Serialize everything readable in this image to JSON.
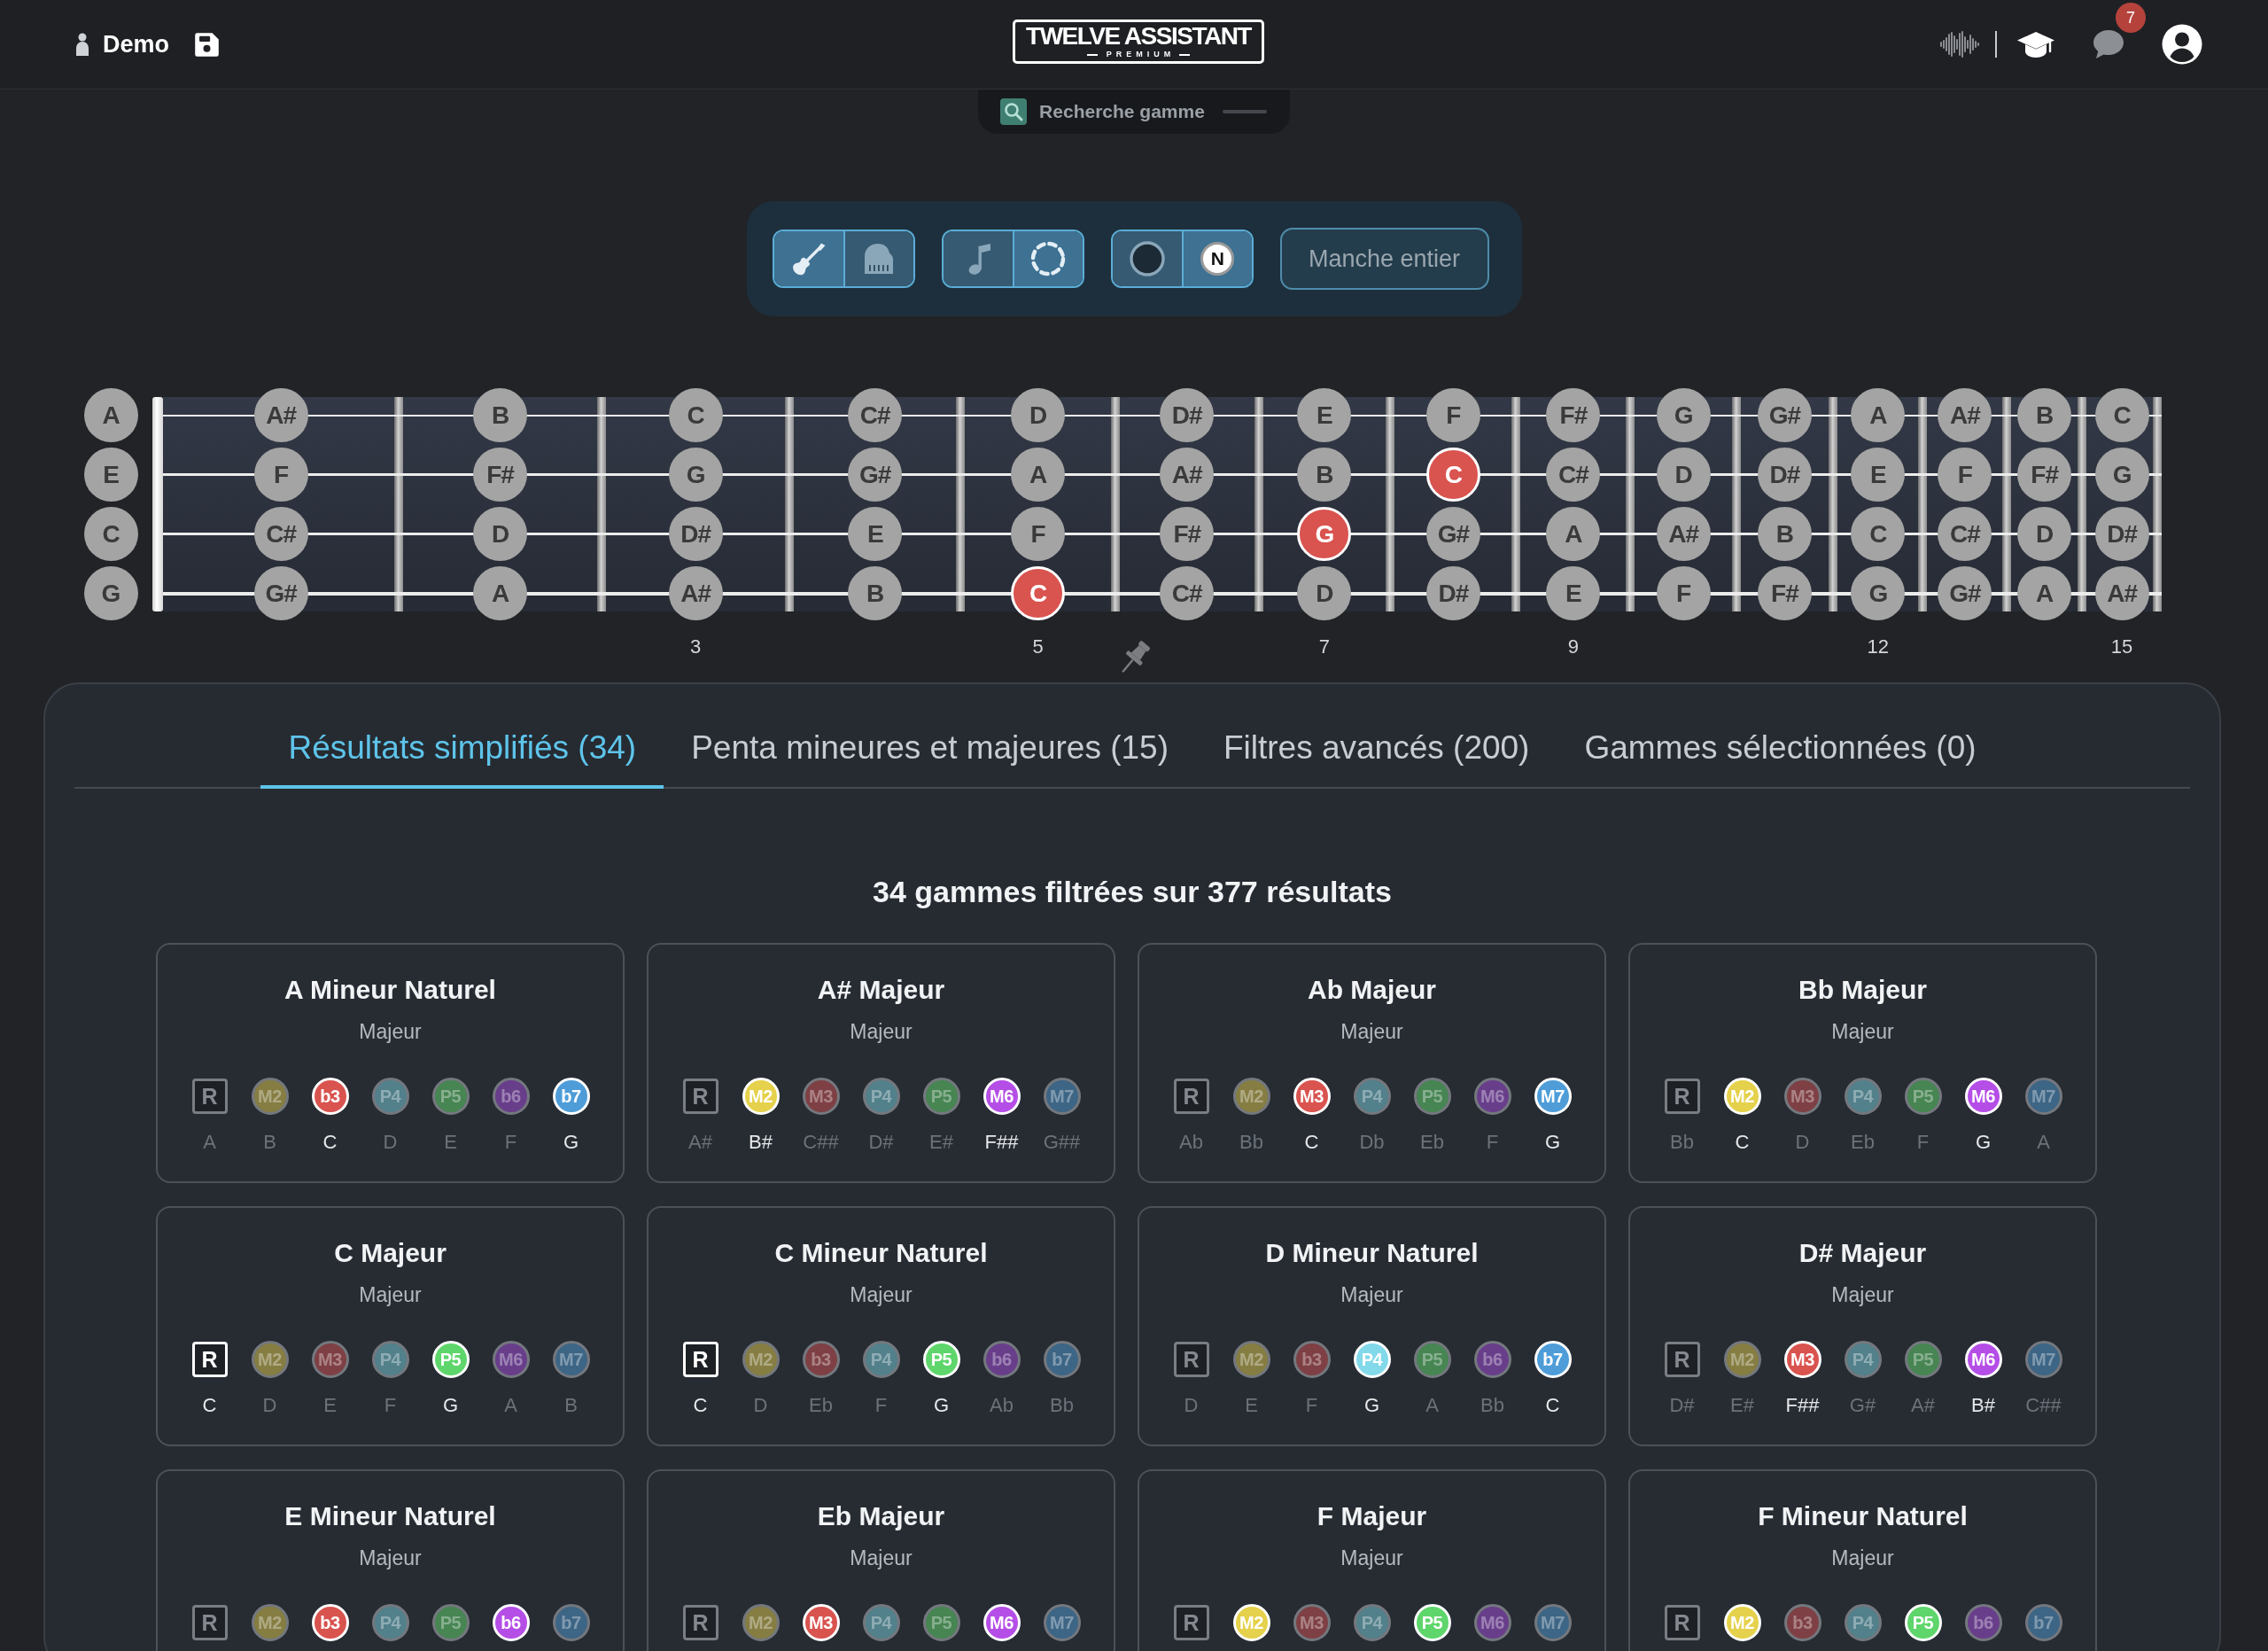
{
  "navbar": {
    "title": "Demo",
    "logo": {
      "title": "TWELVE ASSISTANT",
      "subtitle": "PREMIUM"
    },
    "notification_count": "7"
  },
  "search_tab": {
    "label": "Recherche gamme"
  },
  "toolbar": {
    "groups": [
      [
        {
          "selected": true
        },
        {
          "selected": false
        }
      ],
      [
        {
          "selected": false
        },
        {
          "selected": true
        }
      ],
      [
        {
          "selected": false
        },
        {
          "selected": true,
          "label": "N"
        }
      ]
    ],
    "full_neck_button": "Manche entier"
  },
  "fretboard": {
    "open_strings": [
      {
        "label": "A"
      },
      {
        "label": "E"
      },
      {
        "label": "C"
      },
      {
        "label": "G"
      }
    ],
    "frets": [
      {
        "notes": [
          {
            "label": "A#",
            "highlighted": false
          },
          {
            "label": "F",
            "highlighted": false
          },
          {
            "label": "C#",
            "highlighted": false
          },
          {
            "label": "G#",
            "highlighted": false
          }
        ]
      },
      {
        "notes": [
          {
            "label": "B",
            "highlighted": false
          },
          {
            "label": "F#",
            "highlighted": false
          },
          {
            "label": "D",
            "highlighted": false
          },
          {
            "label": "A",
            "highlighted": false
          }
        ]
      },
      {
        "notes": [
          {
            "label": "C",
            "highlighted": false
          },
          {
            "label": "G",
            "highlighted": false
          },
          {
            "label": "D#",
            "highlighted": false
          },
          {
            "label": "A#",
            "highlighted": false
          }
        ],
        "marker": "3"
      },
      {
        "notes": [
          {
            "label": "C#",
            "highlighted": false
          },
          {
            "label": "G#",
            "highlighted": false
          },
          {
            "label": "E",
            "highlighted": false
          },
          {
            "label": "B",
            "highlighted": false
          }
        ]
      },
      {
        "notes": [
          {
            "label": "D",
            "highlighted": false
          },
          {
            "label": "A",
            "highlighted": false
          },
          {
            "label": "F",
            "highlighted": false
          },
          {
            "label": "C",
            "highlighted": true
          }
        ],
        "marker": "5"
      },
      {
        "notes": [
          {
            "label": "D#",
            "highlighted": false
          },
          {
            "label": "A#",
            "highlighted": false
          },
          {
            "label": "F#",
            "highlighted": false
          },
          {
            "label": "C#",
            "highlighted": false
          }
        ]
      },
      {
        "notes": [
          {
            "label": "E",
            "highlighted": false
          },
          {
            "label": "B",
            "highlighted": false
          },
          {
            "label": "G",
            "highlighted": true
          },
          {
            "label": "D",
            "highlighted": false
          }
        ],
        "marker": "7"
      },
      {
        "notes": [
          {
            "label": "F",
            "highlighted": false
          },
          {
            "label": "C",
            "highlighted": true
          },
          {
            "label": "G#",
            "highlighted": false
          },
          {
            "label": "D#",
            "highlighted": false
          }
        ]
      },
      {
        "notes": [
          {
            "label": "F#",
            "highlighted": false
          },
          {
            "label": "C#",
            "highlighted": false
          },
          {
            "label": "A",
            "highlighted": false
          },
          {
            "label": "E",
            "highlighted": false
          }
        ],
        "marker": "9"
      },
      {
        "notes": [
          {
            "label": "G",
            "highlighted": false
          },
          {
            "label": "D",
            "highlighted": false
          },
          {
            "label": "A#",
            "highlighted": false
          },
          {
            "label": "F",
            "highlighted": false
          }
        ]
      },
      {
        "notes": [
          {
            "label": "G#",
            "highlighted": false
          },
          {
            "label": "D#",
            "highlighted": false
          },
          {
            "label": "B",
            "highlighted": false
          },
          {
            "label": "F#",
            "highlighted": false
          }
        ]
      },
      {
        "notes": [
          {
            "label": "A",
            "highlighted": false
          },
          {
            "label": "E",
            "highlighted": false
          },
          {
            "label": "C",
            "highlighted": false
          },
          {
            "label": "G",
            "highlighted": false
          }
        ],
        "marker": "12"
      },
      {
        "notes": [
          {
            "label": "A#",
            "highlighted": false
          },
          {
            "label": "F",
            "highlighted": false
          },
          {
            "label": "C#",
            "highlighted": false
          },
          {
            "label": "G#",
            "highlighted": false
          }
        ]
      },
      {
        "notes": [
          {
            "label": "B",
            "highlighted": false
          },
          {
            "label": "F#",
            "highlighted": false
          },
          {
            "label": "D",
            "highlighted": false
          },
          {
            "label": "A",
            "highlighted": false
          }
        ]
      },
      {
        "notes": [
          {
            "label": "C",
            "highlighted": false
          },
          {
            "label": "G",
            "highlighted": false
          },
          {
            "label": "D#",
            "highlighted": false
          },
          {
            "label": "A#",
            "highlighted": false
          }
        ],
        "marker": "15"
      }
    ]
  },
  "results": {
    "tabs": [
      {
        "label": "Résultats simplifiés (34)",
        "selected": true
      },
      {
        "label": "Penta mineures et majeures (15)",
        "selected": false
      },
      {
        "label": "Filtres avancés (200)",
        "selected": false
      },
      {
        "label": "Gammes sélectionnées (0)",
        "selected": false
      }
    ],
    "summary": "34 gammes filtrées sur 377 résultats",
    "scales": [
      {
        "title": "A Mineur Naturel",
        "subtitle": "Majeur",
        "intervals": [
          {
            "kind": "root",
            "label": "R",
            "note": "A",
            "active": false
          },
          {
            "kind": "degree",
            "label": "M2",
            "note": "B",
            "active": false,
            "color": "#857d42"
          },
          {
            "kind": "degree",
            "label": "b3",
            "note": "C",
            "active": true,
            "color": "#d9534f"
          },
          {
            "kind": "degree",
            "label": "P4",
            "note": "D",
            "active": false,
            "color": "#52808b"
          },
          {
            "kind": "degree",
            "label": "P5",
            "note": "E",
            "active": false,
            "color": "#478553"
          },
          {
            "kind": "degree",
            "label": "b6",
            "note": "F",
            "active": false,
            "color": "#683e8b"
          },
          {
            "kind": "degree",
            "label": "b7",
            "note": "G",
            "active": true,
            "color": "#4e9dd8"
          }
        ]
      },
      {
        "title": "A# Majeur",
        "subtitle": "Majeur",
        "intervals": [
          {
            "kind": "root",
            "label": "R",
            "note": "A#",
            "active": false
          },
          {
            "kind": "degree",
            "label": "M2",
            "note": "B#",
            "active": true,
            "color": "#e5d14b"
          },
          {
            "kind": "degree",
            "label": "M3",
            "note": "C##",
            "active": false,
            "color": "#7e4044"
          },
          {
            "kind": "degree",
            "label": "P4",
            "note": "D#",
            "active": false,
            "color": "#52808b"
          },
          {
            "kind": "degree",
            "label": "P5",
            "note": "E#",
            "active": false,
            "color": "#478553"
          },
          {
            "kind": "degree",
            "label": "M6",
            "note": "F##",
            "active": true,
            "color": "#b54ee6"
          },
          {
            "kind": "degree",
            "label": "M7",
            "note": "G##",
            "active": false,
            "color": "#3d6585"
          }
        ]
      },
      {
        "title": "Ab Majeur",
        "subtitle": "Majeur",
        "intervals": [
          {
            "kind": "root",
            "label": "R",
            "note": "Ab",
            "active": false
          },
          {
            "kind": "degree",
            "label": "M2",
            "note": "Bb",
            "active": false,
            "color": "#857d42"
          },
          {
            "kind": "degree",
            "label": "M3",
            "note": "C",
            "active": true,
            "color": "#d9534f"
          },
          {
            "kind": "degree",
            "label": "P4",
            "note": "Db",
            "active": false,
            "color": "#52808b"
          },
          {
            "kind": "degree",
            "label": "P5",
            "note": "Eb",
            "active": false,
            "color": "#478553"
          },
          {
            "kind": "degree",
            "label": "M6",
            "note": "F",
            "active": false,
            "color": "#683e8b"
          },
          {
            "kind": "degree",
            "label": "M7",
            "note": "G",
            "active": true,
            "color": "#4e9dd8"
          }
        ]
      },
      {
        "title": "Bb Majeur",
        "subtitle": "Majeur",
        "intervals": [
          {
            "kind": "root",
            "label": "R",
            "note": "Bb",
            "active": false
          },
          {
            "kind": "degree",
            "label": "M2",
            "note": "C",
            "active": true,
            "color": "#e5d14b"
          },
          {
            "kind": "degree",
            "label": "M3",
            "note": "D",
            "active": false,
            "color": "#7e4044"
          },
          {
            "kind": "degree",
            "label": "P4",
            "note": "Eb",
            "active": false,
            "color": "#52808b"
          },
          {
            "kind": "degree",
            "label": "P5",
            "note": "F",
            "active": false,
            "color": "#478553"
          },
          {
            "kind": "degree",
            "label": "M6",
            "note": "G",
            "active": true,
            "color": "#b54ee6"
          },
          {
            "kind": "degree",
            "label": "M7",
            "note": "A",
            "active": false,
            "color": "#3d6585"
          }
        ]
      },
      {
        "title": "C Majeur",
        "subtitle": "Majeur",
        "intervals": [
          {
            "kind": "root",
            "label": "R",
            "note": "C",
            "active": true
          },
          {
            "kind": "degree",
            "label": "M2",
            "note": "D",
            "active": false,
            "color": "#857d42"
          },
          {
            "kind": "degree",
            "label": "M3",
            "note": "E",
            "active": false,
            "color": "#7e4044"
          },
          {
            "kind": "degree",
            "label": "P4",
            "note": "F",
            "active": false,
            "color": "#52808b"
          },
          {
            "kind": "degree",
            "label": "P5",
            "note": "G",
            "active": true,
            "color": "#5ed66b"
          },
          {
            "kind": "degree",
            "label": "M6",
            "note": "A",
            "active": false,
            "color": "#683e8b"
          },
          {
            "kind": "degree",
            "label": "M7",
            "note": "B",
            "active": false,
            "color": "#3d6585"
          }
        ]
      },
      {
        "title": "C Mineur Naturel",
        "subtitle": "Majeur",
        "intervals": [
          {
            "kind": "root",
            "label": "R",
            "note": "C",
            "active": true
          },
          {
            "kind": "degree",
            "label": "M2",
            "note": "D",
            "active": false,
            "color": "#857d42"
          },
          {
            "kind": "degree",
            "label": "b3",
            "note": "Eb",
            "active": false,
            "color": "#7e4044"
          },
          {
            "kind": "degree",
            "label": "P4",
            "note": "F",
            "active": false,
            "color": "#52808b"
          },
          {
            "kind": "degree",
            "label": "P5",
            "note": "G",
            "active": true,
            "color": "#5ed66b"
          },
          {
            "kind": "degree",
            "label": "b6",
            "note": "Ab",
            "active": false,
            "color": "#683e8b"
          },
          {
            "kind": "degree",
            "label": "b7",
            "note": "Bb",
            "active": false,
            "color": "#3d6585"
          }
        ]
      },
      {
        "title": "D Mineur Naturel",
        "subtitle": "Majeur",
        "intervals": [
          {
            "kind": "root",
            "label": "R",
            "note": "D",
            "active": false
          },
          {
            "kind": "degree",
            "label": "M2",
            "note": "E",
            "active": false,
            "color": "#857d42"
          },
          {
            "kind": "degree",
            "label": "b3",
            "note": "F",
            "active": false,
            "color": "#7e4044"
          },
          {
            "kind": "degree",
            "label": "P4",
            "note": "G",
            "active": true,
            "color": "#82d9ea"
          },
          {
            "kind": "degree",
            "label": "P5",
            "note": "A",
            "active": false,
            "color": "#478553"
          },
          {
            "kind": "degree",
            "label": "b6",
            "note": "Bb",
            "active": false,
            "color": "#683e8b"
          },
          {
            "kind": "degree",
            "label": "b7",
            "note": "C",
            "active": true,
            "color": "#4e9dd8"
          }
        ]
      },
      {
        "title": "D# Majeur",
        "subtitle": "Majeur",
        "intervals": [
          {
            "kind": "root",
            "label": "R",
            "note": "D#",
            "active": false
          },
          {
            "kind": "degree",
            "label": "M2",
            "note": "E#",
            "active": false,
            "color": "#857d42"
          },
          {
            "kind": "degree",
            "label": "M3",
            "note": "F##",
            "active": true,
            "color": "#d9534f"
          },
          {
            "kind": "degree",
            "label": "P4",
            "note": "G#",
            "active": false,
            "color": "#52808b"
          },
          {
            "kind": "degree",
            "label": "P5",
            "note": "A#",
            "active": false,
            "color": "#478553"
          },
          {
            "kind": "degree",
            "label": "M6",
            "note": "B#",
            "active": true,
            "color": "#b54ee6"
          },
          {
            "kind": "degree",
            "label": "M7",
            "note": "C##",
            "active": false,
            "color": "#3d6585"
          }
        ]
      },
      {
        "title": "E Mineur Naturel",
        "subtitle": "Majeur",
        "intervals": [
          {
            "kind": "root",
            "label": "R",
            "active": false
          },
          {
            "kind": "degree",
            "label": "M2",
            "active": false,
            "color": "#857d42"
          },
          {
            "kind": "degree",
            "label": "b3",
            "active": true,
            "color": "#d9534f"
          },
          {
            "kind": "degree",
            "label": "P4",
            "active": false,
            "color": "#52808b"
          },
          {
            "kind": "degree",
            "label": "P5",
            "active": false,
            "color": "#478553"
          },
          {
            "kind": "degree",
            "label": "b6",
            "active": true,
            "color": "#b54ee6"
          },
          {
            "kind": "degree",
            "label": "b7",
            "active": false,
            "color": "#3d6585"
          }
        ]
      },
      {
        "title": "Eb Majeur",
        "subtitle": "Majeur",
        "intervals": [
          {
            "kind": "root",
            "label": "R",
            "active": false
          },
          {
            "kind": "degree",
            "label": "M2",
            "active": false,
            "color": "#857d42"
          },
          {
            "kind": "degree",
            "label": "M3",
            "active": true,
            "color": "#d9534f"
          },
          {
            "kind": "degree",
            "label": "P4",
            "active": false,
            "color": "#52808b"
          },
          {
            "kind": "degree",
            "label": "P5",
            "active": false,
            "color": "#478553"
          },
          {
            "kind": "degree",
            "label": "M6",
            "active": true,
            "color": "#b54ee6"
          },
          {
            "kind": "degree",
            "label": "M7",
            "active": false,
            "color": "#3d6585"
          }
        ]
      },
      {
        "title": "F Majeur",
        "subtitle": "Majeur",
        "intervals": [
          {
            "kind": "root",
            "label": "R",
            "active": false
          },
          {
            "kind": "degree",
            "label": "M2",
            "active": true,
            "color": "#e5d14b"
          },
          {
            "kind": "degree",
            "label": "M3",
            "active": false,
            "color": "#7e4044"
          },
          {
            "kind": "degree",
            "label": "P4",
            "active": false,
            "color": "#52808b"
          },
          {
            "kind": "degree",
            "label": "P5",
            "active": true,
            "color": "#5ed66b"
          },
          {
            "kind": "degree",
            "label": "M6",
            "active": false,
            "color": "#683e8b"
          },
          {
            "kind": "degree",
            "label": "M7",
            "active": false,
            "color": "#3d6585"
          }
        ]
      },
      {
        "title": "F Mineur Naturel",
        "subtitle": "Majeur",
        "intervals": [
          {
            "kind": "root",
            "label": "R",
            "active": false
          },
          {
            "kind": "degree",
            "label": "M2",
            "active": true,
            "color": "#e5d14b"
          },
          {
            "kind": "degree",
            "label": "b3",
            "active": false,
            "color": "#7e4044"
          },
          {
            "kind": "degree",
            "label": "P4",
            "active": false,
            "color": "#52808b"
          },
          {
            "kind": "degree",
            "label": "P5",
            "active": true,
            "color": "#5ed66b"
          },
          {
            "kind": "degree",
            "label": "b6",
            "active": false,
            "color": "#683e8b"
          },
          {
            "kind": "degree",
            "label": "b7",
            "active": false,
            "color": "#3d6585"
          }
        ]
      }
    ]
  }
}
